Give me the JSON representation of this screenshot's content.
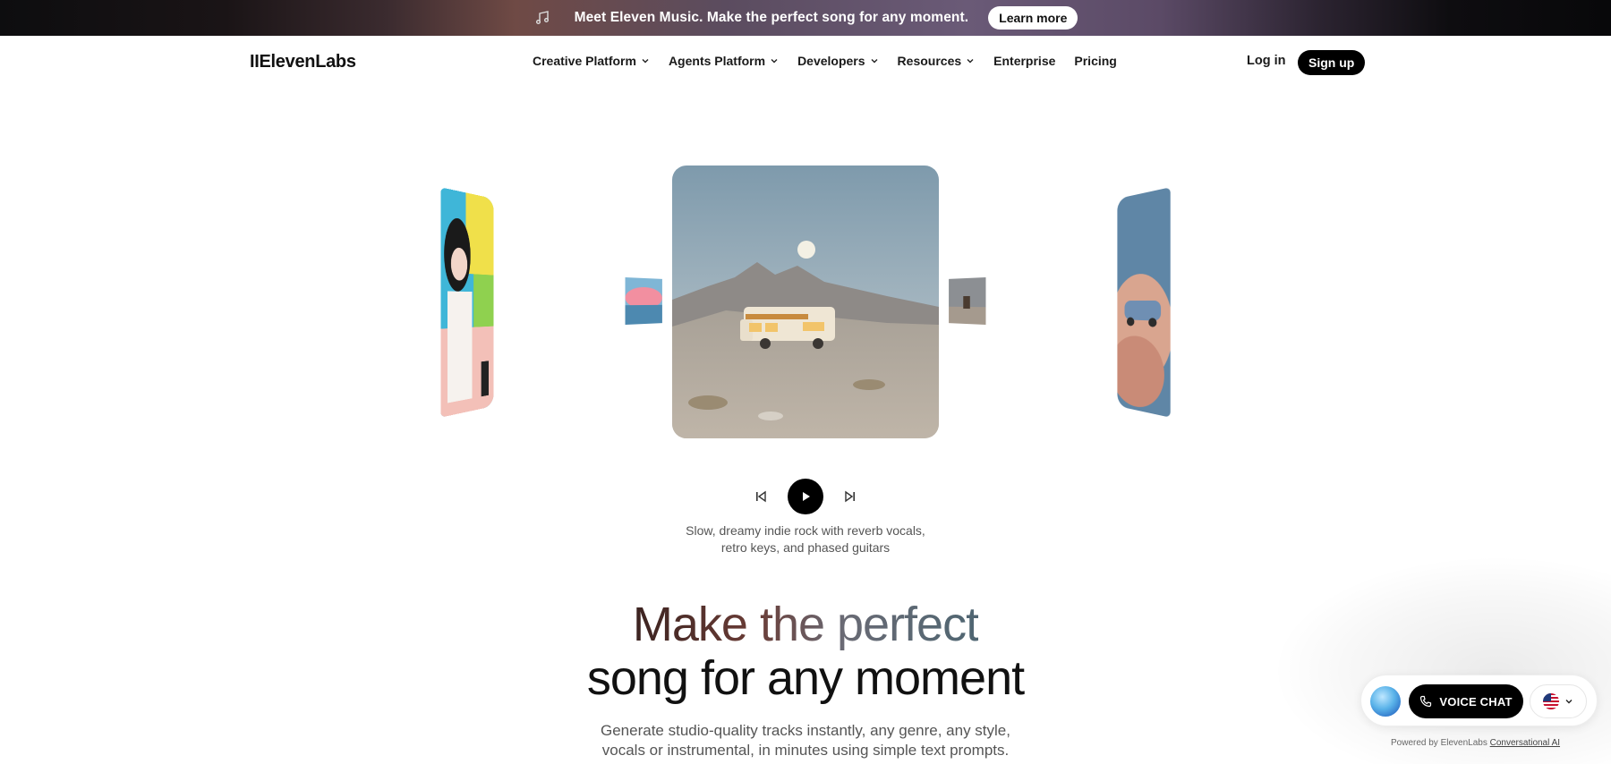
{
  "banner": {
    "icon": "music-note-icon",
    "text": "Meet Eleven Music. Make the perfect song for any moment.",
    "button_label": "Learn more"
  },
  "nav": {
    "logo": "IIElevenLabs",
    "items": [
      {
        "label": "Creative Platform",
        "has_dropdown": true
      },
      {
        "label": "Agents Platform",
        "has_dropdown": true
      },
      {
        "label": "Developers",
        "has_dropdown": true
      },
      {
        "label": "Resources",
        "has_dropdown": true
      },
      {
        "label": "Enterprise",
        "has_dropdown": false
      },
      {
        "label": "Pricing",
        "has_dropdown": false
      }
    ],
    "login_label": "Log in",
    "signup_label": "Sign up"
  },
  "player": {
    "caption_line1": "Slow, dreamy indie rock with reverb vocals,",
    "caption_line2": "retro keys, and phased guitars"
  },
  "hero": {
    "headline_part1": "Make the perfect",
    "headline_part2": "song for any moment",
    "subhead_line1": "Generate studio-quality tracks instantly, any genre, any style,",
    "subhead_line2": "vocals or instrumental, in minutes using simple text prompts."
  },
  "widget": {
    "voice_chat_label": "VOICE CHAT",
    "powered_prefix": "Powered by ElevenLabs",
    "powered_link": "Conversational AI"
  },
  "colors": {
    "accent_black": "#000000",
    "banner_dark": "#0d0d0f"
  }
}
